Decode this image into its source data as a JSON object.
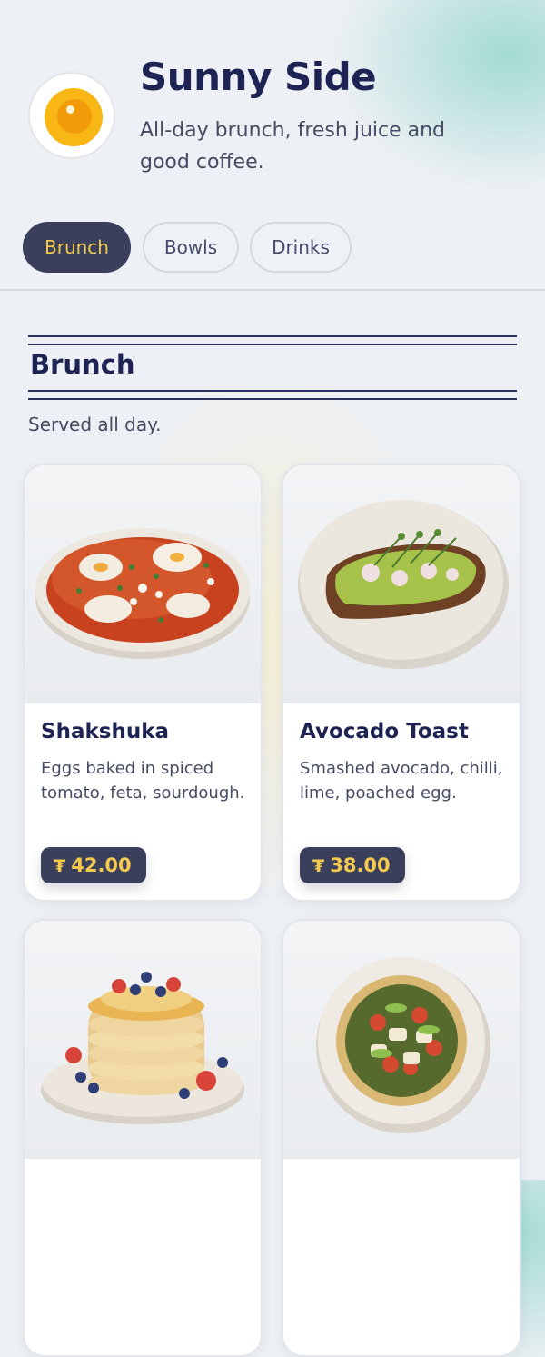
{
  "brand": {
    "name": "Sunny Side",
    "tagline": "All-day brunch, fresh juice and good coffee."
  },
  "tabs": [
    {
      "label": "Brunch",
      "active": true
    },
    {
      "label": "Bowls",
      "active": false
    },
    {
      "label": "Drinks",
      "active": false
    }
  ],
  "section": {
    "title": "Brunch",
    "description": "Served all day."
  },
  "items": [
    {
      "name": "Shakshuka",
      "description": "Eggs baked in spiced tomato, feta, sourdough.",
      "currency": "₮",
      "price": "42.00",
      "photo": "shakshuka-pan-image"
    },
    {
      "name": "Avocado Toast",
      "description": "Smashed avocado, chilli, lime, poached egg.",
      "currency": "₮",
      "price": "38.00",
      "photo": "avocado-toast-plate-image"
    },
    {
      "name": "",
      "description": "",
      "currency": "",
      "price": "",
      "photo": "pancake-stack-berries-image"
    },
    {
      "name": "",
      "description": "",
      "currency": "",
      "price": "",
      "photo": "flatbread-pizza-plate-image"
    }
  ],
  "colors": {
    "accent": "#3a405c",
    "accent_text": "#f5c94d",
    "heading": "#1d2454",
    "body_text": "#454b63"
  }
}
